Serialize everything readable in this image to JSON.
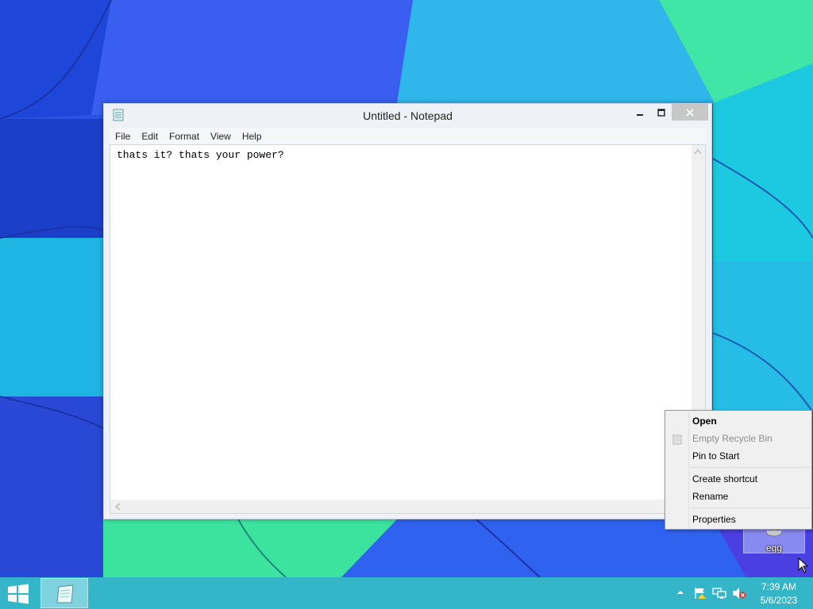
{
  "notepad": {
    "title": "Untitled - Notepad",
    "menu": [
      "File",
      "Edit",
      "Format",
      "View",
      "Help"
    ],
    "content": "thats it? thats your power?"
  },
  "desktop_icon": {
    "label": "egg",
    "icon": "recycle-bin-icon"
  },
  "context_menu": {
    "items": [
      {
        "label": "Open",
        "bold": true,
        "enabled": true
      },
      {
        "label": "Empty Recycle Bin",
        "enabled": false
      },
      {
        "label": "Pin to Start",
        "enabled": true
      },
      {
        "label": "Create shortcut",
        "enabled": true
      },
      {
        "label": "Rename",
        "enabled": true
      },
      {
        "label": "Properties",
        "enabled": true
      }
    ]
  },
  "taskbar": {
    "clock_time": "7:39 AM",
    "clock_date": "5/6/2023",
    "pinned": [
      "notepad-icon"
    ],
    "tray_icons": [
      "show-hidden-icons-chevron",
      "action-center-flag-icon",
      "network-icon",
      "volume-muted-icon"
    ]
  },
  "colors": {
    "taskbar": "#35b6c8",
    "wallpaper_blue": "#2a4ee0",
    "wallpaper_cyan": "#1cc9e0",
    "wallpaper_green": "#38e89a"
  }
}
